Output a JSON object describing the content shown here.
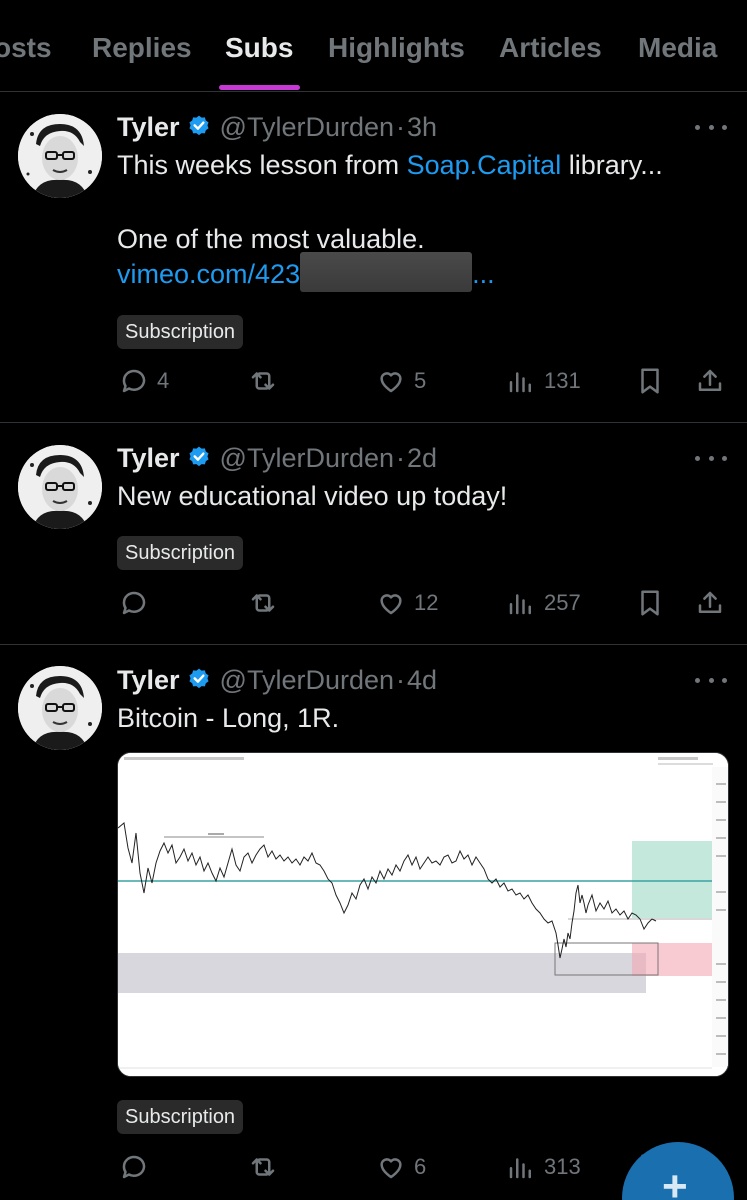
{
  "tabs": [
    {
      "label": "osts"
    },
    {
      "label": "Replies"
    },
    {
      "label": "Subs"
    },
    {
      "label": "Highlights"
    },
    {
      "label": "Articles"
    },
    {
      "label": "Media"
    }
  ],
  "active_tab": "Subs",
  "posts": [
    {
      "author": "Tyler",
      "handle": "@TylerDurden",
      "time": "3h",
      "text1_prefix": "This weeks lesson from ",
      "text1_link": "Soap.Capital",
      "text1_suffix": " library...",
      "text2": "One of the most valuable.",
      "link_visible": "vimeo.com/423",
      "link_tail": "...",
      "badge": "Subscription",
      "replies": "4",
      "likes": "5",
      "views": "131"
    },
    {
      "author": "Tyler",
      "handle": "@TylerDurden",
      "time": "2d",
      "text1": "New educational video up today!",
      "badge": "Subscription",
      "replies": "",
      "likes": "12",
      "views": "257"
    },
    {
      "author": "Tyler",
      "handle": "@TylerDurden",
      "time": "4d",
      "text1": "Bitcoin - Long, 1R.",
      "badge": "Subscription",
      "replies": "",
      "likes": "6",
      "views": "313"
    }
  ],
  "colors": {
    "background": "#000000",
    "accent_tab": "#c639d4",
    "link": "#1d9bf0",
    "muted": "#71767b",
    "verified": "#1d9bf0"
  },
  "icons": [
    "reply-icon",
    "retweet-icon",
    "like-icon",
    "views-icon",
    "bookmark-icon",
    "share-icon",
    "more-icon",
    "verified-badge-icon",
    "compose-plus-icon"
  ]
}
